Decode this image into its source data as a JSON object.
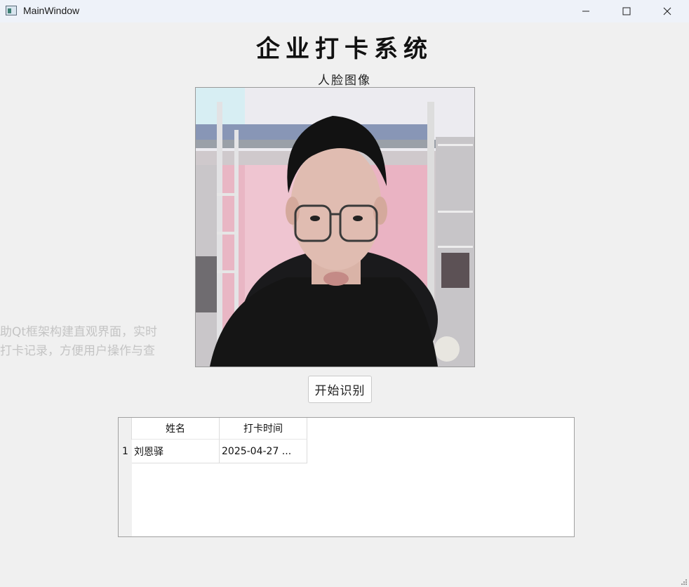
{
  "window": {
    "title": "MainWindow",
    "icon": "app-window-icon"
  },
  "controls": {
    "minimize": "minimize-icon",
    "maximize": "maximize-icon",
    "close": "close-icon"
  },
  "main": {
    "heading": "企业打卡系统",
    "face_label": "人脸图像",
    "ghost_text": [
      "助Qt框架构建直观界面，实时",
      "打卡记录，方便用户操作与查"
    ],
    "start_button": "开始识别"
  },
  "table": {
    "headers": [
      "姓名",
      "打卡时间"
    ],
    "rows": [
      {
        "index": "1",
        "name": "刘恩驿",
        "time": "2025-04-27 ..."
      }
    ]
  }
}
